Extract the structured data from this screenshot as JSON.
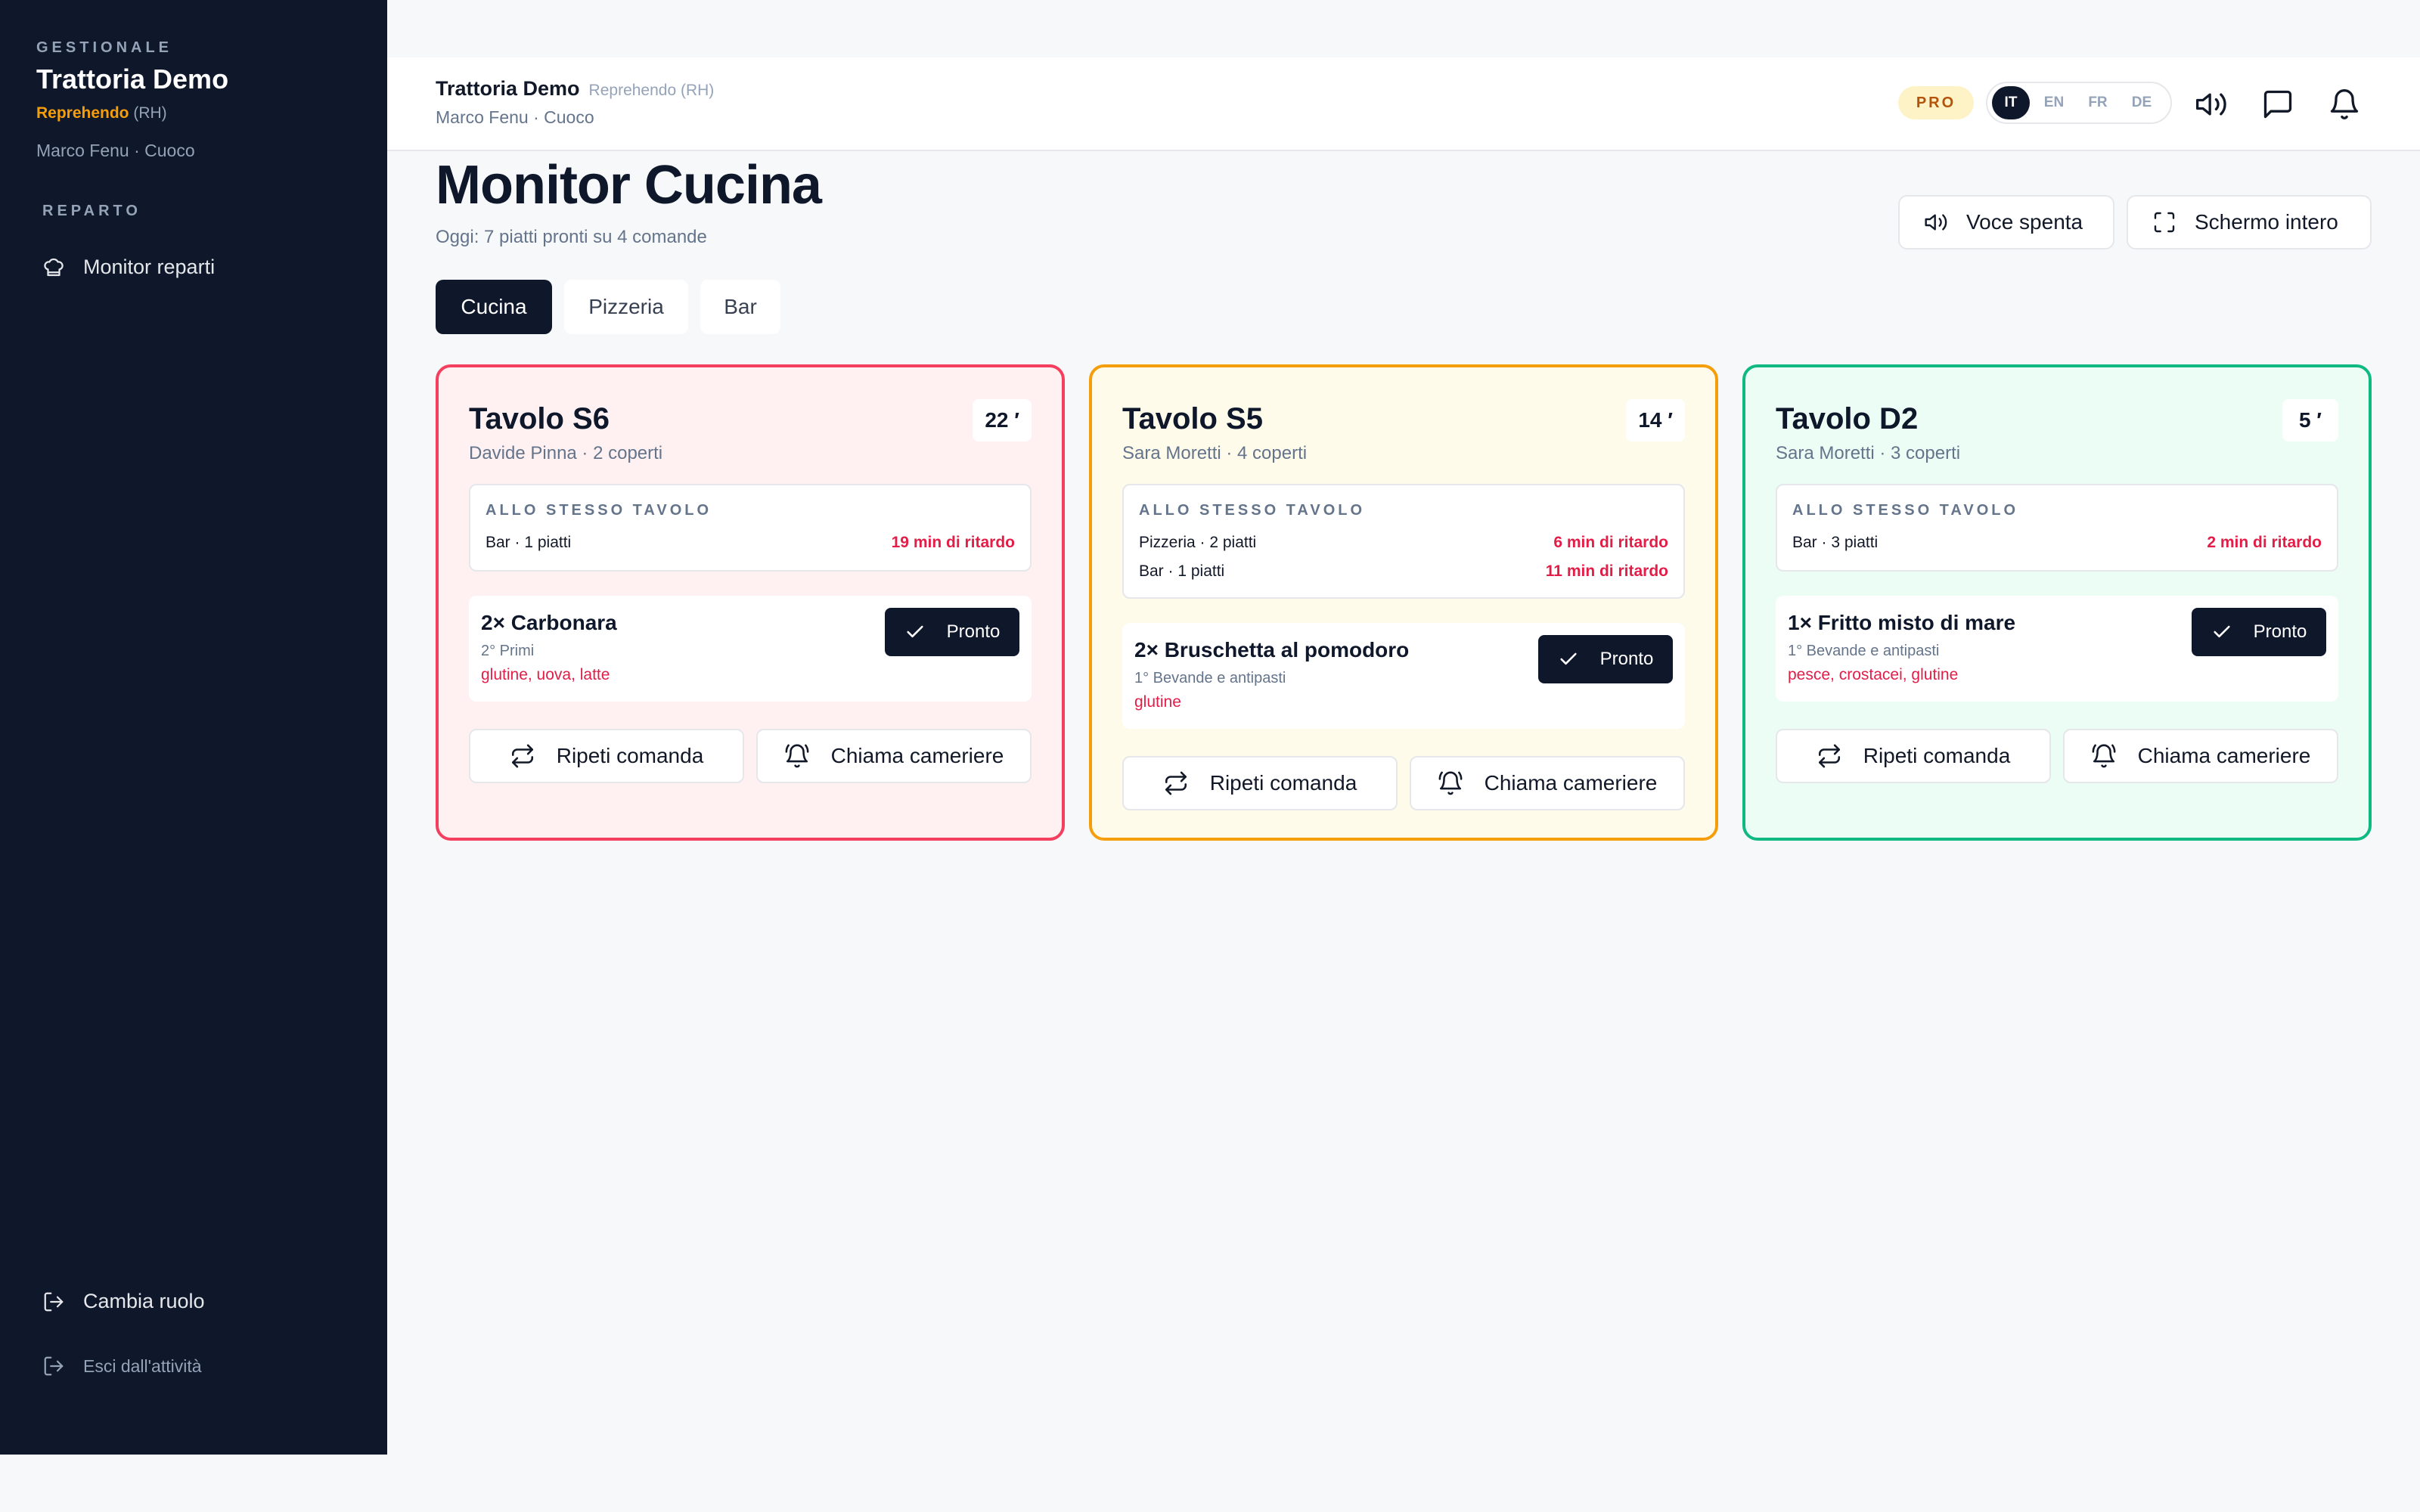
{
  "sidebar": {
    "kicker": "GESTIONALE",
    "title": "Trattoria Demo",
    "brand": "Reprehendo",
    "brand_code": "(RH)",
    "user": "Marco Fenu · Cuoco",
    "section": "REPARTO",
    "nav": [
      {
        "label": "Monitor reparti",
        "icon": "chef-hat-icon"
      }
    ],
    "switch_role": "Cambia ruolo",
    "logout": "Esci dall'attività"
  },
  "header": {
    "title": "Trattoria Demo",
    "subtitle": "Reprehendo (RH)",
    "user": "Marco Fenu · Cuoco",
    "badge": "PRO",
    "languages": [
      "IT",
      "EN",
      "FR",
      "DE"
    ],
    "active_language": "IT",
    "icons": [
      "volume-icon",
      "chat-icon",
      "bell-icon"
    ]
  },
  "page": {
    "title": "Monitor Cucina",
    "subtitle": "Oggi: 7 piatti pronti su 4 comande",
    "voice_button": "Voce spenta",
    "fullscreen_button": "Schermo intero"
  },
  "tabs": [
    {
      "label": "Cucina",
      "active": true
    },
    {
      "label": "Pizzeria",
      "active": false
    },
    {
      "label": "Bar",
      "active": false
    }
  ],
  "same_table_label": "ALLO STESSO TAVOLO",
  "ready_label": "Pronto",
  "repeat_label": "Ripeti comanda",
  "call_label": "Chiama cameriere",
  "cards": [
    {
      "title": "Tavolo S6",
      "sub": "Davide Pinna · 2 coperti",
      "timer": "22 ′",
      "status_color": "#f43f5e",
      "same_table": [
        {
          "station": "Bar · 1 piatti",
          "delay": "19 min di ritardo"
        }
      ],
      "dish": {
        "name": "2× Carbonara",
        "category": "2° Primi",
        "allergens": "glutine, uova, latte"
      }
    },
    {
      "title": "Tavolo S5",
      "sub": "Sara Moretti · 4 coperti",
      "timer": "14 ′",
      "status_color": "#f59e0b",
      "same_table": [
        {
          "station": "Pizzeria · 2 piatti",
          "delay": "6 min di ritardo"
        },
        {
          "station": "Bar · 1 piatti",
          "delay": "11 min di ritardo"
        }
      ],
      "dish": {
        "name": "2× Bruschetta al pomodoro",
        "category": "1° Bevande e antipasti",
        "allergens": "glutine"
      }
    },
    {
      "title": "Tavolo D2",
      "sub": "Sara Moretti · 3 coperti",
      "timer": "5 ′",
      "status_color": "#10b981",
      "same_table": [
        {
          "station": "Bar · 3 piatti",
          "delay": "2 min di ritardo"
        }
      ],
      "dish": {
        "name": "1× Fritto misto di mare",
        "category": "1° Bevande e antipasti",
        "allergens": "pesce, crostacei, glutine"
      }
    }
  ]
}
